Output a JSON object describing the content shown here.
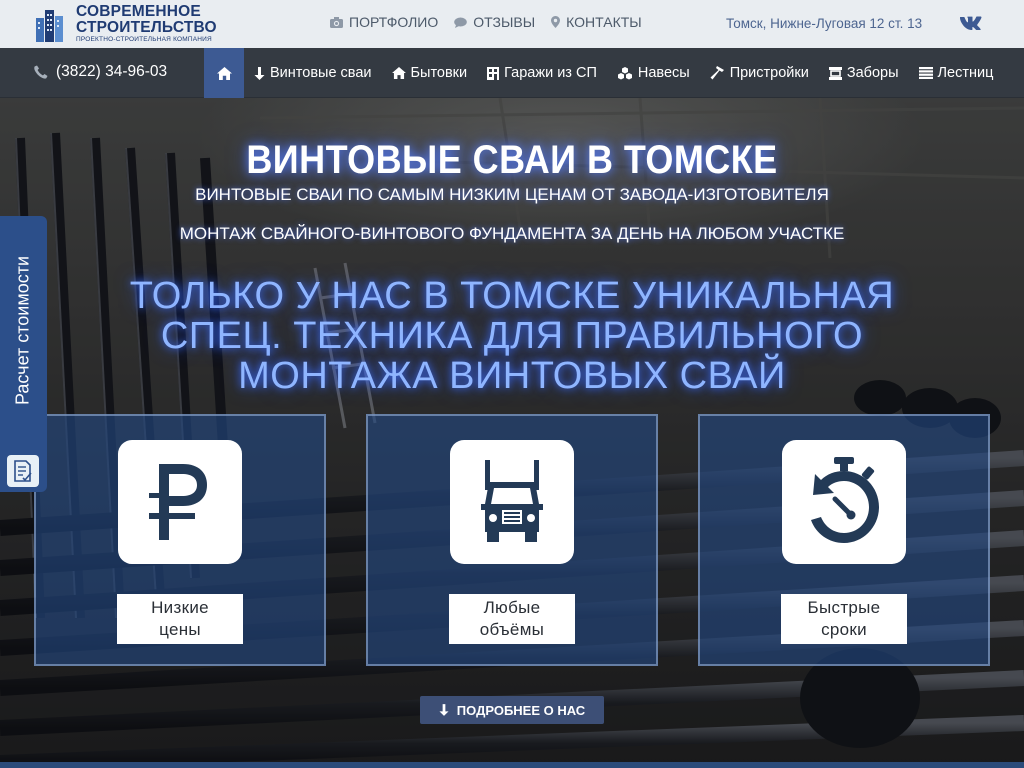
{
  "header": {
    "logo": {
      "line1": "СОВРЕМЕННОЕ",
      "line2": "СТРОИТЕЛЬСТВО",
      "line3": "ПРОЕКТНО-СТРОИТЕЛЬНАЯ КОМПАНИЯ"
    },
    "top_links": [
      {
        "label": "ПОРТФОЛИО",
        "icon": "camera-icon"
      },
      {
        "label": "ОТЗЫВЫ",
        "icon": "chat-icon"
      },
      {
        "label": "КОНТАКТЫ",
        "icon": "map-pin-icon"
      }
    ],
    "address": "Томск, Нижне-Луговая 12 ст. 13",
    "social": "vk-icon"
  },
  "nav": {
    "phone": "(3822) 34-96-03",
    "home_icon": "home-icon",
    "items": [
      {
        "label": "Винтовые сваи",
        "icon": "arrow-down-icon"
      },
      {
        "label": "Бытовки",
        "icon": "home-icon"
      },
      {
        "label": "Гаражи из СП",
        "icon": "garage-icon"
      },
      {
        "label": "Навесы",
        "icon": "cubes-icon"
      },
      {
        "label": "Пристройки",
        "icon": "hammer-icon"
      },
      {
        "label": "Заборы",
        "icon": "fence-icon"
      },
      {
        "label": "Лестниц",
        "icon": "list-icon"
      }
    ]
  },
  "hero": {
    "title": "ВИНТОВЫЕ СВАИ В ТОМСКЕ",
    "subtitle1": "ВИНТОВЫЕ СВАИ ПО САМЫМ НИЗКИМ ЦЕНАМ ОТ ЗАВОДА-ИЗГОТОВИТЕЛЯ",
    "subtitle2": "МОНТАЖ СВАЙНОГО-ВИНТОВОГО ФУНДАМЕНТА ЗА ДЕНЬ НА ЛЮБОМ УЧАСТКЕ",
    "big_lines": [
      "ТОЛЬКО У НАС В ТОМСКЕ УНИКАЛЬНАЯ",
      "СПЕЦ. ТЕХНИКА ДЛЯ ПРАВИЛЬНОГО",
      "МОНТАЖА ВИНТОВЫХ СВАЙ"
    ],
    "cards": [
      {
        "icon": "ruble-icon",
        "line1": "Низкие",
        "line2": "цены"
      },
      {
        "icon": "truck-icon",
        "line1": "Любые",
        "line2": "объёмы"
      },
      {
        "icon": "stopwatch-icon",
        "line1": "Быстрые",
        "line2": "сроки"
      }
    ],
    "more_button": "ПОДРОБНЕЕ О НАС"
  },
  "side_tab": {
    "label": "Расчет стоимости",
    "icon": "calculator-doc-icon"
  },
  "colors": {
    "accent": "#3d5a93",
    "navbar": "#343a42",
    "topbar": "#e9edf1",
    "brand_text": "#1f3b73",
    "glow": "#8fb5ff"
  }
}
